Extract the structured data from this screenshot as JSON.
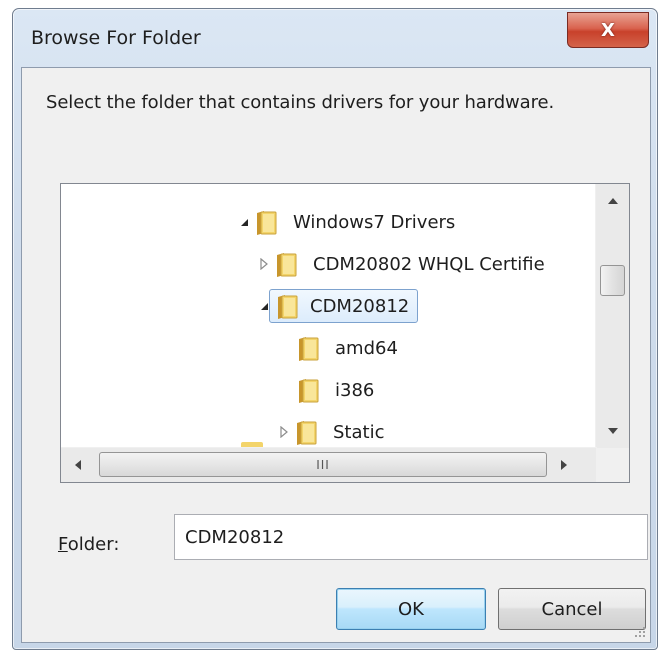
{
  "window": {
    "title": "Browse For Folder",
    "close_label": "X"
  },
  "dialog": {
    "instruction": "Select the folder that contains drivers for your hardware."
  },
  "tree": {
    "rows": [
      {
        "label": "Windows7 Drivers",
        "expander": "expanded"
      },
      {
        "label": "CDM20802  WHQL Certifie",
        "expander": "collapsed"
      },
      {
        "label": "CDM20812",
        "expander": "expanded",
        "selected": true
      },
      {
        "label": "amd64",
        "expander": "none"
      },
      {
        "label": "i386",
        "expander": "none"
      },
      {
        "label": "Static",
        "expander": "collapsed"
      }
    ],
    "hscroll_thumb_grip": "III"
  },
  "folder_field": {
    "label_accel": "F",
    "label_rest": "older:",
    "value": "CDM20812"
  },
  "buttons": {
    "ok_label": "OK",
    "cancel_label": "Cancel"
  },
  "colors": {
    "selection_border": "#7da2ce",
    "close_red": "#c8412b",
    "folder_yellow": "#e8c04a"
  }
}
